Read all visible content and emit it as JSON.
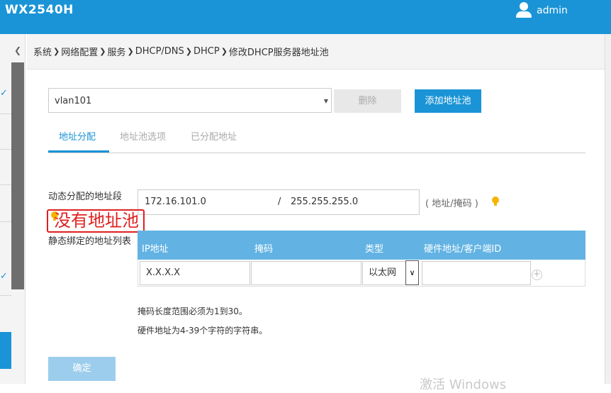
{
  "header": {
    "brand": "WX2540H",
    "user": "admin"
  },
  "breadcrumb": [
    "系统",
    "网络配置",
    "服务",
    "DHCP/DNS",
    "DHCP",
    "修改DHCP服务器地址池"
  ],
  "pool_select": {
    "value": "vlan101"
  },
  "buttons": {
    "delete": "删除",
    "add_pool": "添加地址池",
    "ok": "确定"
  },
  "tabs": [
    {
      "label": "地址分配",
      "active": true
    },
    {
      "label": "地址池选项",
      "active": false
    },
    {
      "label": "已分配地址",
      "active": false
    }
  ],
  "dynamic": {
    "label": "动态分配的地址段",
    "network": "172.16.101.0",
    "separator": "/",
    "mask": "255.255.255.0",
    "hint": "( 地址/掩码 )"
  },
  "annotation": "没有地址池",
  "static": {
    "label": "静态绑定的地址列表",
    "columns": [
      "IP地址",
      "掩码",
      "类型",
      "硬件地址/客户端ID"
    ],
    "row": {
      "ip": "X.X.X.X",
      "mask": "",
      "type": "以太网",
      "hw": ""
    }
  },
  "notes": [
    "掩码长度范围必须为1到30。",
    "硬件地址为4-39个字符的字符串。"
  ],
  "watermark": "激活 Windows",
  "colors": {
    "accent": "#1a94d6",
    "table_header": "#62b3e3",
    "annotation": "#e02020"
  }
}
